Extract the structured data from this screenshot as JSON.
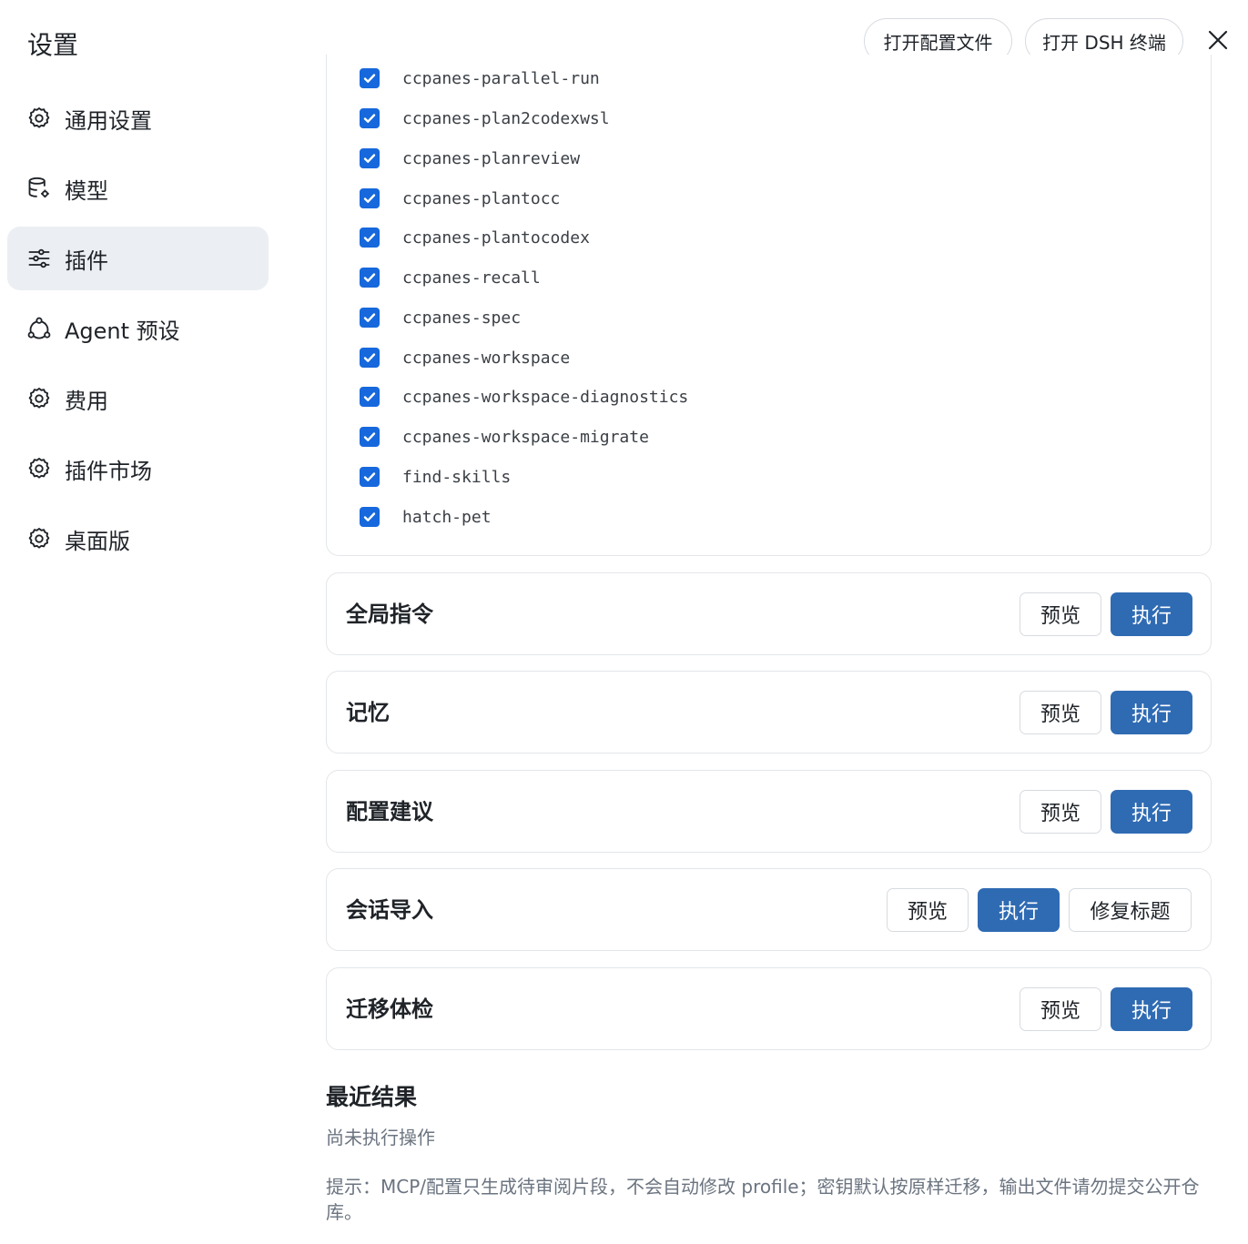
{
  "header": {
    "title": "设置",
    "open_config_label": "打开配置文件",
    "open_terminal_label": "打开 DSH 终端"
  },
  "sidebar": {
    "items": [
      {
        "label": "通用设置",
        "icon": "gear-icon",
        "active": false
      },
      {
        "label": "模型",
        "icon": "database-gear-icon",
        "active": false
      },
      {
        "label": "插件",
        "icon": "sliders-icon",
        "active": true
      },
      {
        "label": "Agent 预设",
        "icon": "network-icon",
        "active": false
      },
      {
        "label": "费用",
        "icon": "gear-icon",
        "active": false
      },
      {
        "label": "插件市场",
        "icon": "gear-icon",
        "active": false
      },
      {
        "label": "桌面版",
        "icon": "gear-icon",
        "active": false
      }
    ]
  },
  "skills": [
    {
      "name": "ccpanes-parallel-run",
      "checked": true
    },
    {
      "name": "ccpanes-plan2codexwsl",
      "checked": true
    },
    {
      "name": "ccpanes-planreview",
      "checked": true
    },
    {
      "name": "ccpanes-plantocc",
      "checked": true
    },
    {
      "name": "ccpanes-plantocodex",
      "checked": true
    },
    {
      "name": "ccpanes-recall",
      "checked": true
    },
    {
      "name": "ccpanes-spec",
      "checked": true
    },
    {
      "name": "ccpanes-workspace",
      "checked": true
    },
    {
      "name": "ccpanes-workspace-diagnostics",
      "checked": true
    },
    {
      "name": "ccpanes-workspace-migrate",
      "checked": true
    },
    {
      "name": "find-skills",
      "checked": true
    },
    {
      "name": "hatch-pet",
      "checked": true
    }
  ],
  "actions": [
    {
      "title": "全局指令",
      "preview_label": "预览",
      "run_label": "执行"
    },
    {
      "title": "记忆",
      "preview_label": "预览",
      "run_label": "执行"
    },
    {
      "title": "配置建议",
      "preview_label": "预览",
      "run_label": "执行"
    },
    {
      "title": "会话导入",
      "preview_label": "预览",
      "run_label": "执行",
      "fix_label": "修复标题"
    },
    {
      "title": "迁移体检",
      "preview_label": "预览",
      "run_label": "执行"
    }
  ],
  "recent": {
    "title": "最近结果",
    "empty_text": "尚未执行操作"
  },
  "hint": "提示：MCP/配置只生成待审阅片段，不会自动修改 profile；密钥默认按原样迁移，输出文件请勿提交公开仓库。",
  "colors": {
    "accent": "#2f6bb3",
    "checkbox": "#1668dc",
    "active_nav_bg": "#ebeef2"
  }
}
